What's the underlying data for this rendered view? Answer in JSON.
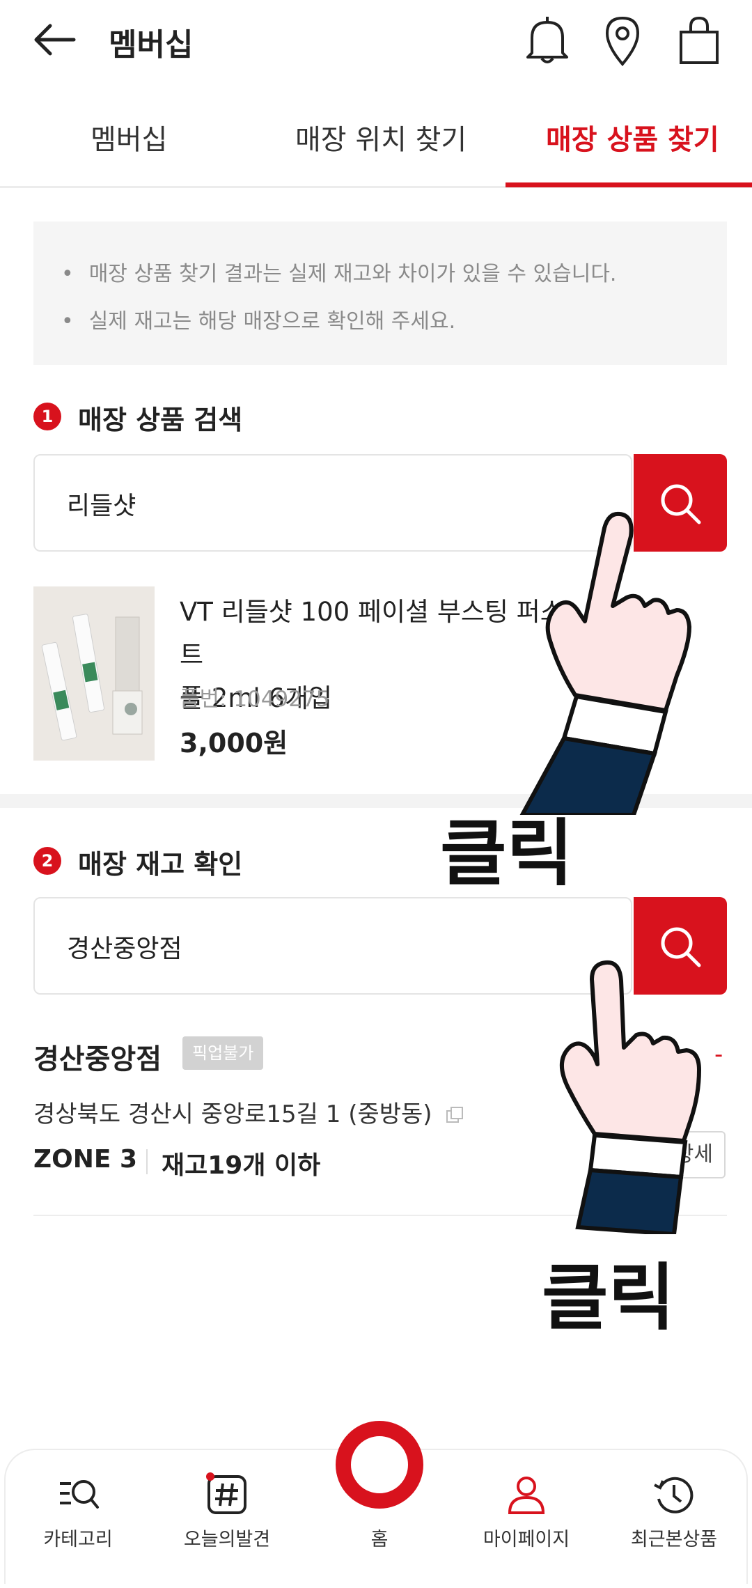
{
  "header": {
    "title": "멤버십",
    "icons": [
      "back-arrow-icon",
      "bell-icon",
      "location-pin-icon",
      "shopping-bag-icon"
    ]
  },
  "tabs": [
    {
      "label": "멤버십",
      "active": false
    },
    {
      "label": "매장 위치 찾기",
      "active": false
    },
    {
      "label": "매장 상품 찾기",
      "active": true
    }
  ],
  "notice": {
    "bullet": "•",
    "lines": [
      "매장 상품 찾기 결과는 실제 재고와 차이가 있을 수 있습니다.",
      "실제 재고는 해당 매장으로 확인해 주세요."
    ]
  },
  "product_search": {
    "step": "1",
    "title": "매장 상품 검색",
    "query": "리들샷",
    "result": {
      "title_line1": "VT 리들샷 100 페이셜 부스팅 퍼스트",
      "title_line2": "플 2ml 6개입",
      "code": "품번: 1049275",
      "price": "3,000원"
    }
  },
  "stock_check": {
    "step": "2",
    "title": "매장 재고 확인",
    "query": "경산중앙점",
    "store": {
      "name": "경산중앙점",
      "badge": "픽업불가",
      "address": "경상북도 경산시 중앙로15길 1 (중방동)",
      "zone": "ZONE 3",
      "stock": "재고19개 이하",
      "detail_button": "상세",
      "dash": "-"
    }
  },
  "annotations": {
    "click_label_1": "클릭",
    "click_label_2": "클릭"
  },
  "bottom_nav": [
    {
      "label": "카테고리",
      "icon": "category-search-icon"
    },
    {
      "label": "오늘의발견",
      "icon": "hashtag-icon"
    },
    {
      "label": "홈",
      "icon": "home-ring-icon"
    },
    {
      "label": "마이페이지",
      "icon": "person-icon"
    },
    {
      "label": "최근본상품",
      "icon": "history-icon"
    }
  ],
  "colors": {
    "accent": "#d8121d",
    "notice_bg": "#f5f5f5",
    "text": "#222222",
    "muted": "#8a8a8a"
  }
}
